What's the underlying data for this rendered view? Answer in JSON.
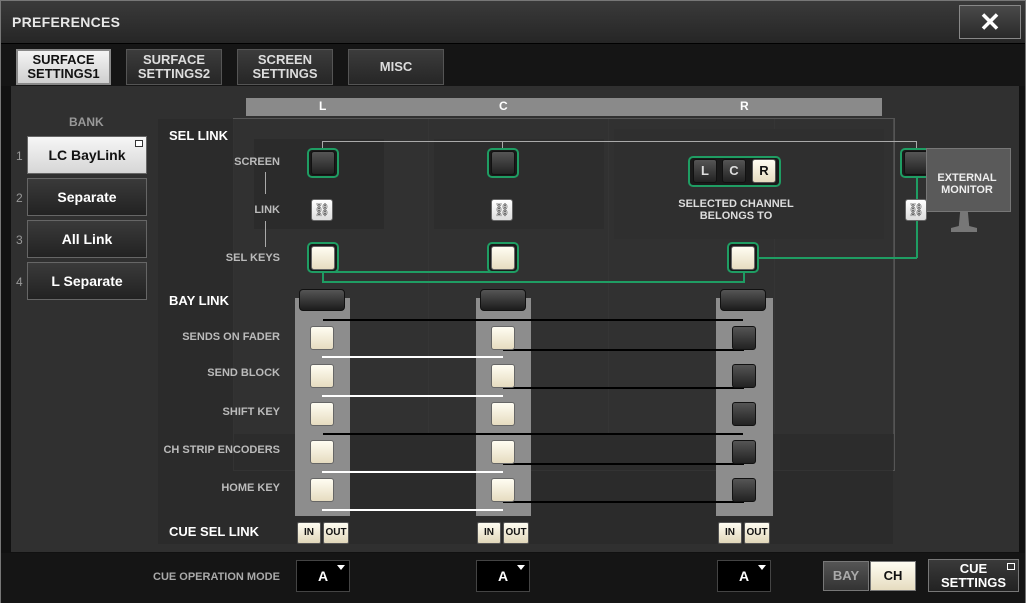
{
  "window": {
    "title": "PREFERENCES",
    "close_icon": "close-icon"
  },
  "tabs": [
    {
      "label": "SURFACE\nSETTINGS1",
      "active": true
    },
    {
      "label": "SURFACE\nSETTINGS2",
      "active": false
    },
    {
      "label": "SCREEN\nSETTINGS",
      "active": false
    },
    {
      "label": "MISC",
      "active": false
    }
  ],
  "bays": {
    "left": "L",
    "center": "C",
    "right": "R"
  },
  "bank": {
    "label": "BANK",
    "items": [
      {
        "num": "1",
        "label": "LC BayLink",
        "selected": true
      },
      {
        "num": "2",
        "label": "Separate",
        "selected": false
      },
      {
        "num": "3",
        "label": "All Link",
        "selected": false
      },
      {
        "num": "4",
        "label": "L Separate",
        "selected": false
      }
    ]
  },
  "sel_link": {
    "title": "SEL LINK",
    "rows": {
      "screen": "SCREEN",
      "link": "LINK",
      "sel_keys": "SEL KEYS"
    },
    "selected_channel_caption": "SELECTED CHANNEL\nBELONGS TO",
    "channel_buttons": [
      {
        "label": "L",
        "on": false
      },
      {
        "label": "C",
        "on": false
      },
      {
        "label": "R",
        "on": true
      }
    ],
    "external_monitor": "EXTERNAL\nMONITOR"
  },
  "bay_link": {
    "title": "BAY LINK",
    "rows": [
      "SENDS ON FADER",
      "SEND BLOCK",
      "SHIFT KEY",
      "CH STRIP ENCODERS",
      "HOME KEY"
    ]
  },
  "cue_sel_link": {
    "title": "CUE SEL LINK",
    "in": "IN",
    "out": "OUT"
  },
  "cue_operation_mode": {
    "label": "CUE OPERATION MODE",
    "values": {
      "left": "A",
      "center": "A",
      "right": "A"
    }
  },
  "bay_ch": {
    "bay": "BAY",
    "ch": "CH",
    "active": "CH"
  },
  "cue_settings": "CUE\nSETTINGS",
  "colors": {
    "accent_green": "#1f9d63",
    "active_cream": "#f2ead2"
  }
}
